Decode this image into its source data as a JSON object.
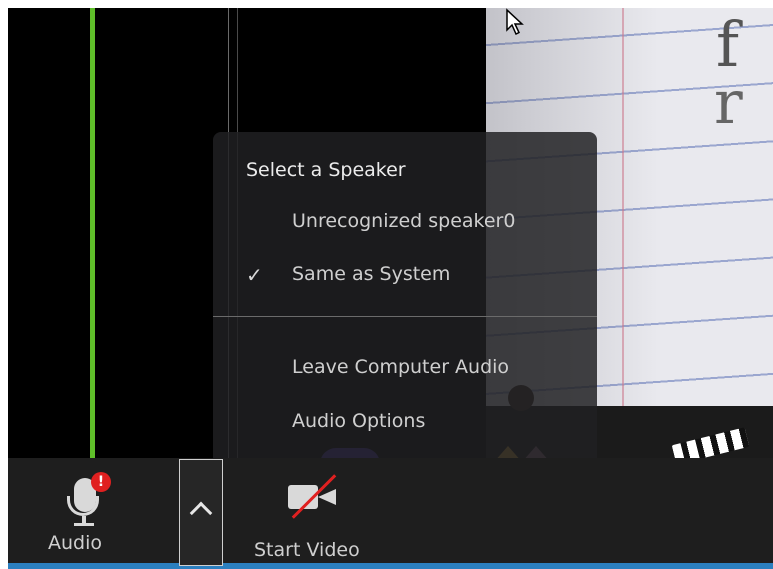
{
  "menu": {
    "title": "Select a Speaker",
    "items": [
      {
        "label": "Unrecognized speaker0",
        "checked": false
      },
      {
        "label": "Same as System",
        "checked": true
      },
      {
        "label": "Leave Computer Audio",
        "checked": false
      },
      {
        "label": "Audio Options",
        "checked": false
      }
    ],
    "check_glyph": "✓"
  },
  "toolbar": {
    "audio_label": "Audio",
    "audio_alert": "!",
    "video_label": "Start Video"
  },
  "icons": {
    "microphone": "microphone-icon",
    "alert": "alert-badge-icon",
    "chevron": "chevron-up-icon",
    "camera_off": "video-camera-off-icon",
    "cursor": "mouse-pointer-icon"
  },
  "colors": {
    "accent_green": "#5fbf2a",
    "alert_red": "#e02020",
    "toolbar_bg": "#1e1e1e",
    "bottom_bar_blue": "#2b7fbf"
  }
}
